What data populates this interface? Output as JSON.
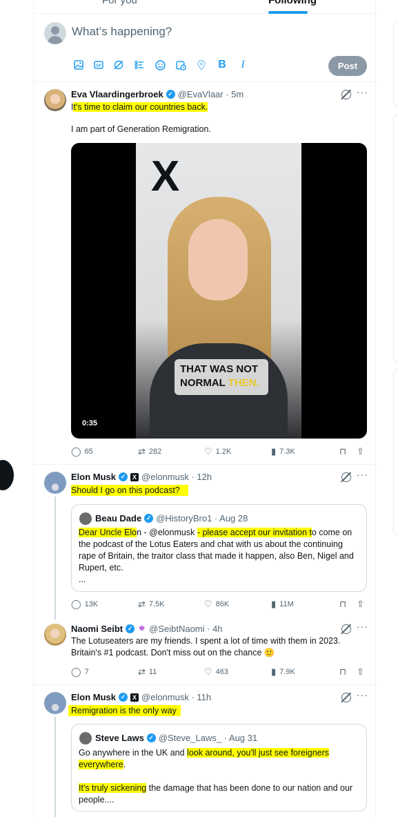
{
  "tabs": [
    {
      "label": "For you"
    },
    {
      "label": "Following"
    }
  ],
  "compose": {
    "placeholder": "What’s happening?",
    "post_label": "Post",
    "tools": [
      "image-icon",
      "gif-icon",
      "grok-icon",
      "poll-icon",
      "emoji-icon",
      "schedule-icon",
      "location-icon",
      "bold-icon",
      "italic-icon"
    ]
  },
  "tweets": [
    {
      "name": "Eva Vlaardingerbroek",
      "handle": "@EvaVlaar · 5m",
      "text_hl": "It's time to claim our countries back.",
      "text2": "I am part of Generation Remigration.",
      "media": {
        "logo": "X",
        "caption1": "THAT WAS NOT",
        "caption2": "NORMAL",
        "caption3": "THEN.",
        "duration": "0:35"
      },
      "stats": {
        "replies": "65",
        "reposts": "282",
        "likes": "1.2K",
        "views": "7.3K"
      }
    },
    {
      "name": "Elon Musk",
      "handle": "@elonmusk · 12h",
      "text_hl": "Should I go on this podcast?",
      "quote": {
        "name": "Beau Dade",
        "handle": "@HistoryBro1 · Aug 28",
        "seg1": "Dear Uncle Elo",
        "seg2": "n - @elonmusk ",
        "seg3": "- please accept our invitation t",
        "seg4": "o come on the podcast of the Lotus Eaters and chat with us about the continuing rape of Britain, the traitor class that made it happen, also Ben, Nigel and Rupert, etc.",
        "ellipsis": "..."
      },
      "stats": {
        "replies": "13K",
        "reposts": "7.5K",
        "likes": "86K",
        "views": "11M"
      }
    },
    {
      "name": "Naomi Seibt",
      "handle": "@SeibtNaomi · 4h",
      "text1": "The Lotuseaters are my friends. I spent a lot of time with them in 2023.",
      "text2": "Britain's #1 podcast. Don't miss out on the chance 🙂",
      "stats": {
        "replies": "7",
        "reposts": "11",
        "likes": "463",
        "views": "7.9K"
      }
    },
    {
      "name": "Elon Musk",
      "handle": "@elonmusk · 11h",
      "text_hl": "Remigration is the only way",
      "quote": {
        "name": "Steve Laws",
        "handle": "@Steve_Laws_ · Aug 31",
        "seg1": "Go anywhere in the UK and ",
        "seg2": "look around, you'll just see foreigners",
        "seg3": "everywhere",
        "seg4": ".",
        "seg5": "It's truly sickening",
        "seg6": " the damage that has been done to our nation and our",
        "seg7": "people...."
      }
    }
  ],
  "icons": {
    "reply": "reply-icon",
    "repost": "repost-icon",
    "like": "like-icon",
    "views": "views-icon",
    "bookmark": "bookmark-icon",
    "share": "share-icon"
  },
  "colors": {
    "accent": "#1d9bf0",
    "highlight": "#ffff00",
    "muted": "#536471"
  }
}
